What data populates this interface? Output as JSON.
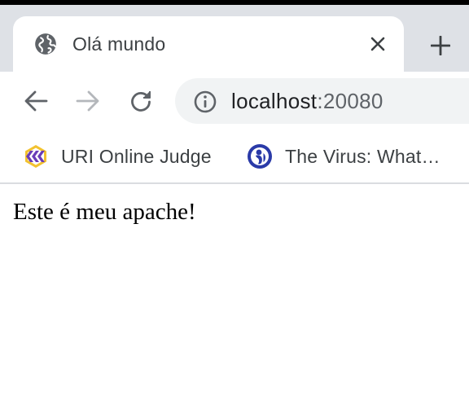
{
  "tab": {
    "title": "Olá mundo",
    "favicon": "globe-icon"
  },
  "toolbar": {
    "back": "back-arrow-icon",
    "forward": "forward-arrow-icon",
    "reload": "reload-icon",
    "url_host": "localhost",
    "url_port": ":20080"
  },
  "bookmarks": [
    {
      "label": "URI Online Judge",
      "icon": "uri-judge-icon"
    },
    {
      "label": "The Virus: What…",
      "icon": "pbs-icon"
    }
  ],
  "page": {
    "text": "Este é meu apache!"
  },
  "colors": {
    "tab_strip": "#dee1e6",
    "omnibox": "#f1f3f4",
    "icon_gray": "#5f6368",
    "uri_accent": "#6a3db8",
    "uri_yellow": "#f2c230",
    "pbs_blue": "#2a3aa8"
  }
}
